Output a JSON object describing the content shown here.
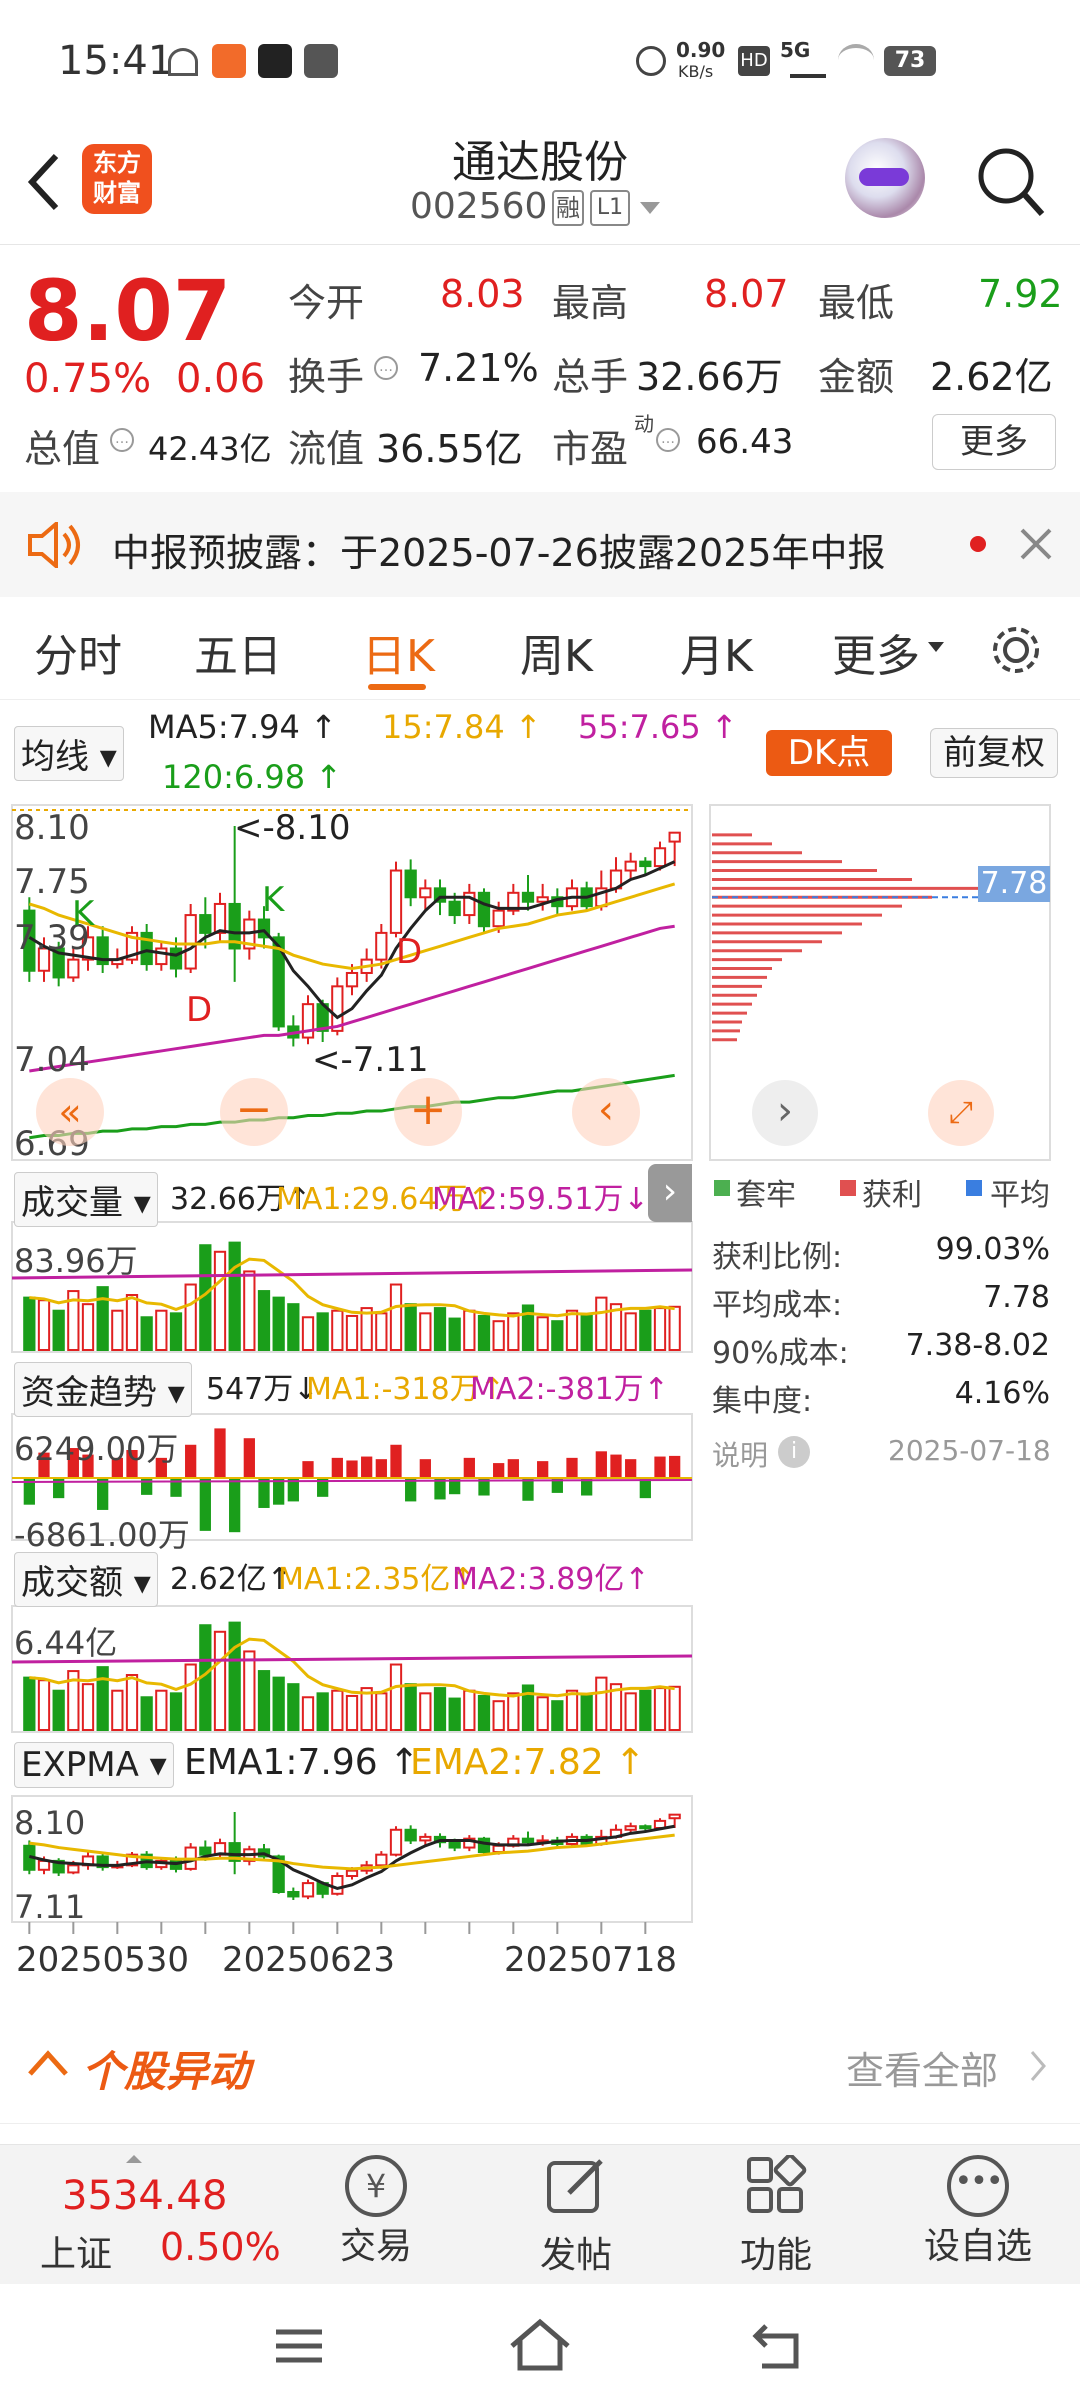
{
  "status_bar": {
    "time": "15:41",
    "net_speed": "0.90",
    "net_unit": "KB/s",
    "network": "5G",
    "battery": "73"
  },
  "header": {
    "title": "通达股份",
    "code": "002560",
    "badge_rong": "融",
    "badge_level": "L1",
    "logo_line1": "东方",
    "logo_line2": "财富"
  },
  "quote": {
    "price": "8.07",
    "change_pct": "0.75%",
    "change": "0.06",
    "open_label": "今开",
    "open": "8.03",
    "high_label": "最高",
    "high": "8.07",
    "low_label": "最低",
    "low": "7.92",
    "turnover_label": "换手",
    "turnover": "7.21%",
    "volume_label": "总手",
    "volume": "32.66万",
    "amount_label": "金额",
    "amount": "2.62亿",
    "mktcap_label": "总值",
    "mktcap": "42.43亿",
    "float_label": "流值",
    "float": "36.55亿",
    "pe_label": "市盈",
    "pe_sup": "动",
    "pe": "66.43",
    "more_btn": "更多"
  },
  "notice": {
    "text": "中报预披露：于2025-07-26披露2025年中报"
  },
  "tabs": {
    "items": [
      "分时",
      "五日",
      "日K",
      "周K",
      "月K",
      "更多"
    ],
    "active": 2
  },
  "ma_bar": {
    "selector": "均线",
    "ma5": "MA5:7.94 ↑",
    "ma15": "15:7.84 ↑",
    "ma55": "55:7.65 ↑",
    "ma120": "120:6.98 ↑",
    "dk_btn": "DK点",
    "fq_btn": "前复权"
  },
  "kline": {
    "y_labels": [
      "8.10",
      "7.75",
      "7.39",
      "7.04",
      "6.69"
    ],
    "max_label": "<-8.10",
    "min_label": "<-7.11",
    "x_labels": [
      "20250530",
      "20250623",
      "20250718"
    ],
    "markers": [
      "K",
      "K",
      "D",
      "D"
    ]
  },
  "chip": {
    "price_tag": "7.78",
    "legend": [
      "套牢",
      "获利",
      "平均"
    ],
    "rows": [
      {
        "label": "获利比例:",
        "value": "99.03%"
      },
      {
        "label": "平均成本:",
        "value": "7.78"
      },
      {
        "label": "90%成本:",
        "value": "7.38-8.02"
      },
      {
        "label": "集中度:",
        "value": "4.16%"
      }
    ],
    "note_label": "说明",
    "date": "2025-07-18"
  },
  "volume_panel": {
    "selector": "成交量",
    "val": "32.66万↑",
    "ma1": "MA1:29.64万↑",
    "ma2": "MA2:59.51万↓",
    "y_top": "83.96万"
  },
  "fund_panel": {
    "selector": "资金趋势",
    "val": "547万↓",
    "ma1": "MA1:-318万↑",
    "ma2": "MA2:-381万↑",
    "y_top": "6249.00万",
    "y_bottom": "-6861.00万"
  },
  "amount_panel": {
    "selector": "成交额",
    "val": "2.62亿↑",
    "ma1": "MA1:2.35亿↑",
    "ma2": "MA2:3.89亿↑",
    "y_top": "6.44亿"
  },
  "expma_panel": {
    "selector": "EXPMA",
    "ema1": "EMA1:7.96 ↑",
    "ema2": "EMA2:7.82 ↑",
    "y_top": "8.10",
    "y_bottom": "7.11"
  },
  "abnormal": {
    "title": "个股异动",
    "view_all": "查看全部"
  },
  "bottom_nav": {
    "index_value": "3534.48",
    "index_name": "上证",
    "index_change": "0.50%",
    "items": [
      "交易",
      "发帖",
      "功能",
      "设自选"
    ]
  },
  "chart_data": {
    "type": "candlestick",
    "dates_shown": [
      "20250530",
      "20250623",
      "20250718"
    ],
    "y_axis": [
      6.69,
      7.04,
      7.39,
      7.75,
      8.1
    ],
    "candles": [
      [
        7.72,
        7.45,
        7.78,
        7.4
      ],
      [
        7.45,
        7.55,
        7.6,
        7.4
      ],
      [
        7.55,
        7.42,
        7.58,
        7.38
      ],
      [
        7.42,
        7.5,
        7.55,
        7.4
      ],
      [
        7.5,
        7.6,
        7.65,
        7.45
      ],
      [
        7.6,
        7.48,
        7.65,
        7.44
      ],
      [
        7.48,
        7.5,
        7.55,
        7.46
      ],
      [
        7.5,
        7.62,
        7.65,
        7.48
      ],
      [
        7.62,
        7.48,
        7.66,
        7.45
      ],
      [
        7.48,
        7.55,
        7.58,
        7.45
      ],
      [
        7.55,
        7.46,
        7.6,
        7.42
      ],
      [
        7.46,
        7.7,
        7.75,
        7.44
      ],
      [
        7.7,
        7.62,
        7.78,
        7.55
      ],
      [
        7.62,
        7.75,
        7.8,
        7.58
      ],
      [
        7.75,
        7.55,
        8.1,
        7.4
      ],
      [
        7.55,
        7.68,
        7.72,
        7.5
      ],
      [
        7.68,
        7.6,
        7.74,
        7.55
      ],
      [
        7.6,
        7.2,
        7.62,
        7.18
      ],
      [
        7.2,
        7.15,
        7.25,
        7.11
      ],
      [
        7.15,
        7.3,
        7.34,
        7.12
      ],
      [
        7.3,
        7.18,
        7.32,
        7.13
      ],
      [
        7.18,
        7.38,
        7.42,
        7.16
      ],
      [
        7.38,
        7.44,
        7.48,
        7.34
      ],
      [
        7.44,
        7.5,
        7.55,
        7.4
      ],
      [
        7.5,
        7.62,
        7.66,
        7.46
      ],
      [
        7.62,
        7.9,
        7.94,
        7.6
      ],
      [
        7.9,
        7.78,
        7.95,
        7.74
      ],
      [
        7.78,
        7.82,
        7.86,
        7.72
      ],
      [
        7.82,
        7.76,
        7.86,
        7.7
      ],
      [
        7.76,
        7.7,
        7.8,
        7.66
      ],
      [
        7.7,
        7.8,
        7.84,
        7.66
      ],
      [
        7.8,
        7.65,
        7.82,
        7.62
      ],
      [
        7.65,
        7.72,
        7.76,
        7.62
      ],
      [
        7.72,
        7.8,
        7.84,
        7.7
      ],
      [
        7.8,
        7.76,
        7.88,
        7.72
      ],
      [
        7.76,
        7.78,
        7.84,
        7.72
      ],
      [
        7.78,
        7.74,
        7.82,
        7.7
      ],
      [
        7.74,
        7.82,
        7.86,
        7.72
      ],
      [
        7.82,
        7.74,
        7.85,
        7.72
      ],
      [
        7.74,
        7.82,
        7.9,
        7.72
      ],
      [
        7.82,
        7.9,
        7.96,
        7.8
      ],
      [
        7.9,
        7.94,
        7.98,
        7.86
      ],
      [
        7.94,
        7.92,
        7.96,
        7.88
      ],
      [
        7.92,
        8.0,
        8.03,
        7.9
      ],
      [
        8.03,
        8.07,
        8.07,
        7.92
      ]
    ],
    "ma5": [
      7.6,
      7.56,
      7.53,
      7.52,
      7.51,
      7.5,
      7.5,
      7.52,
      7.54,
      7.53,
      7.52,
      7.55,
      7.6,
      7.63,
      7.62,
      7.62,
      7.63,
      7.56,
      7.45,
      7.38,
      7.3,
      7.24,
      7.28,
      7.36,
      7.43,
      7.55,
      7.64,
      7.72,
      7.78,
      7.78,
      7.78,
      7.75,
      7.73,
      7.73,
      7.73,
      7.75,
      7.77,
      7.78,
      7.78,
      7.8,
      7.82,
      7.86,
      7.88,
      7.91,
      7.94
    ],
    "ma15": [
      7.75,
      7.73,
      7.7,
      7.68,
      7.66,
      7.64,
      7.62,
      7.6,
      7.59,
      7.58,
      7.57,
      7.57,
      7.57,
      7.58,
      7.58,
      7.57,
      7.56,
      7.55,
      7.52,
      7.5,
      7.48,
      7.47,
      7.46,
      7.47,
      7.48,
      7.5,
      7.52,
      7.54,
      7.56,
      7.58,
      7.6,
      7.62,
      7.64,
      7.65,
      7.66,
      7.68,
      7.7,
      7.71,
      7.72,
      7.74,
      7.76,
      7.78,
      7.8,
      7.82,
      7.84
    ],
    "ma55": [
      7.0,
      7.01,
      7.02,
      7.03,
      7.04,
      7.05,
      7.06,
      7.07,
      7.08,
      7.09,
      7.1,
      7.11,
      7.12,
      7.13,
      7.14,
      7.15,
      7.16,
      7.16,
      7.17,
      7.18,
      7.19,
      7.2,
      7.22,
      7.24,
      7.26,
      7.28,
      7.3,
      7.32,
      7.34,
      7.36,
      7.38,
      7.4,
      7.42,
      7.44,
      7.46,
      7.48,
      7.5,
      7.52,
      7.54,
      7.56,
      7.58,
      7.6,
      7.62,
      7.64,
      7.65
    ],
    "ma120": [
      6.7,
      6.71,
      6.71,
      6.72,
      6.72,
      6.73,
      6.73,
      6.74,
      6.74,
      6.75,
      6.75,
      6.76,
      6.76,
      6.77,
      6.77,
      6.78,
      6.78,
      6.79,
      6.79,
      6.8,
      6.8,
      6.81,
      6.81,
      6.82,
      6.82,
      6.83,
      6.84,
      6.84,
      6.85,
      6.86,
      6.86,
      6.87,
      6.88,
      6.88,
      6.89,
      6.9,
      6.91,
      6.91,
      6.92,
      6.93,
      6.94,
      6.95,
      6.96,
      6.97,
      6.98
    ],
    "volume_wan": [
      40,
      38,
      30,
      45,
      35,
      48,
      30,
      42,
      25,
      30,
      28,
      50,
      80,
      75,
      82,
      60,
      45,
      40,
      35,
      25,
      28,
      30,
      26,
      32,
      28,
      50,
      35,
      28,
      32,
      24,
      30,
      26,
      22,
      28,
      34,
      25,
      22,
      30,
      26,
      40,
      35,
      28,
      30,
      32,
      33
    ]
  }
}
